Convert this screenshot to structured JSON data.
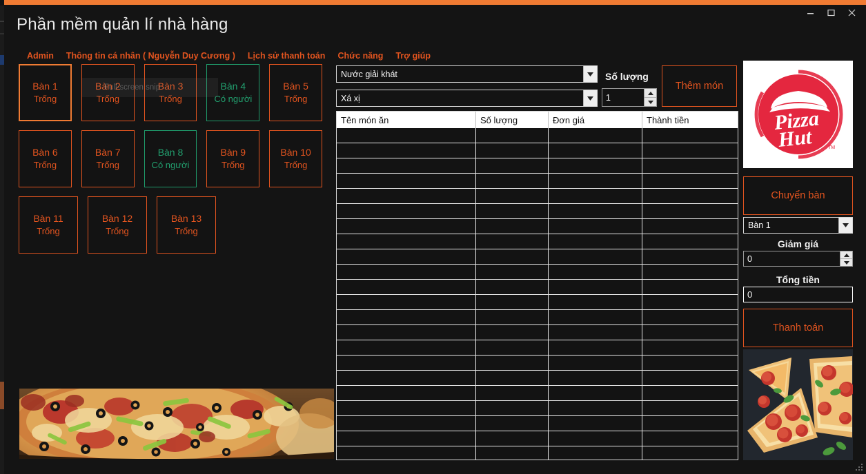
{
  "window": {
    "title": "Phần mềm quản lí nhà hàng",
    "accent_color": "#f07b33",
    "controls": {
      "minimize": "minimize-icon",
      "maximize": "maximize-icon",
      "close": "close-icon"
    }
  },
  "menubar": {
    "items": [
      {
        "label": "Admin"
      },
      {
        "label": "Thông tin cá nhân ( Nguyễn Duy Cương )"
      },
      {
        "label": "Lịch sử thanh toán"
      },
      {
        "label": "Chức năng"
      },
      {
        "label": "Trợ giúp"
      }
    ]
  },
  "tables": {
    "status_empty": "Trống",
    "status_occupied": "Có người",
    "rows": [
      [
        {
          "name": "Bàn 1",
          "status": "Trống",
          "state": "empty",
          "selected": true
        },
        {
          "name": "Bàn 2",
          "status": "Trống",
          "state": "empty",
          "selected": false
        },
        {
          "name": "Bàn 3",
          "status": "Trống",
          "state": "empty",
          "selected": false
        },
        {
          "name": "Bàn 4",
          "status": "Có người",
          "state": "occupied",
          "selected": false
        },
        {
          "name": "Bàn 5",
          "status": "Trống",
          "state": "empty",
          "selected": false
        }
      ],
      [
        {
          "name": "Bàn 6",
          "status": "Trống",
          "state": "empty",
          "selected": false
        },
        {
          "name": "Bàn 7",
          "status": "Trống",
          "state": "empty",
          "selected": false
        },
        {
          "name": "Bàn 8",
          "status": "Có người",
          "state": "occupied",
          "selected": false
        },
        {
          "name": "Bàn 9",
          "status": "Trống",
          "state": "empty",
          "selected": false
        },
        {
          "name": "Bàn 10",
          "status": "Trống",
          "state": "empty",
          "selected": false
        }
      ],
      [
        {
          "name": "Bàn 11",
          "status": "Trống",
          "state": "empty",
          "selected": false
        },
        {
          "name": "Bàn 12",
          "status": "Trống",
          "state": "empty",
          "selected": false
        },
        {
          "name": "Bàn 13",
          "status": "Trống",
          "state": "empty",
          "selected": false
        }
      ]
    ]
  },
  "overlay": {
    "snip_tooltip": "Full-screen snip"
  },
  "order_form": {
    "category": {
      "value": "Nước giải khát"
    },
    "item": {
      "value": "Xá xị"
    },
    "quantity_label": "Số lượng",
    "quantity_value": "1",
    "add_button": "Thêm món"
  },
  "order_table": {
    "columns": [
      "Tên món ăn",
      "Số lượng",
      "Đơn giá",
      "Thành tiền"
    ],
    "rows": [],
    "empty_row_count": 22
  },
  "right_panel": {
    "logo": "pizza-hut-logo",
    "transfer_button": "Chuyển bàn",
    "table_select": {
      "value": "Bàn 1"
    },
    "discount_label": "Giảm giá",
    "discount_value": "0",
    "total_label": "Tổng tiền",
    "total_value": "0",
    "pay_button": "Thanh toán",
    "photo": "pepperoni-pizza-photo"
  },
  "banner": {
    "photo": "supreme-pizza-photo"
  },
  "colors": {
    "accent_orange": "#e2541f",
    "accent_orange_light": "#f07b33",
    "occupied_green": "#22a06f",
    "window_bg": "#141414",
    "grid_line": "#e7e7e7"
  }
}
